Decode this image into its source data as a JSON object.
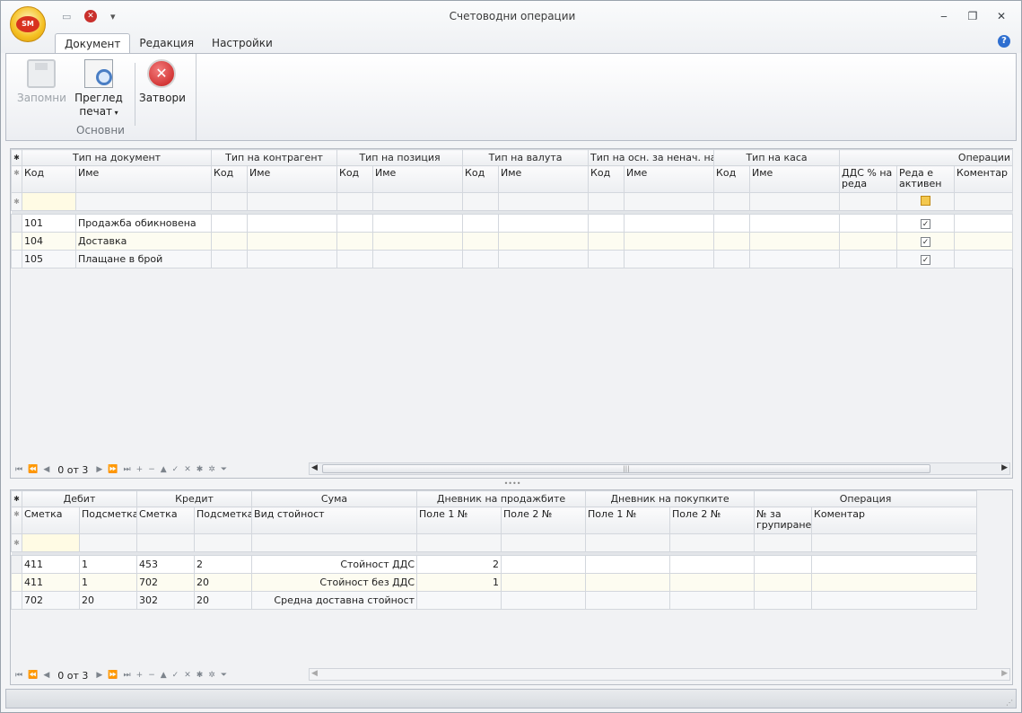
{
  "window": {
    "title": "Счетоводни операции"
  },
  "logo": {
    "text": "SM"
  },
  "tabs": [
    {
      "label": "Документ",
      "active": true
    },
    {
      "label": "Редакция",
      "active": false
    },
    {
      "label": "Настройки",
      "active": false
    }
  ],
  "ribbon": {
    "save_label": "Запомни",
    "preview_label_1": "Преглед",
    "preview_label_2": "печат",
    "close_label": "Затвори",
    "group_label": "Основни"
  },
  "top_grid": {
    "bands": [
      "Тип на документ",
      "Тип на контрагент",
      "Тип на позиция",
      "Тип на валута",
      "Тип на осн. за ненач. на...",
      "Тип на каса",
      "Операции"
    ],
    "code_header": "Код",
    "name_header": "Име",
    "vat_header": "ДДС % на реда",
    "active_header": "Реда е активен",
    "comment_header": "Коментар",
    "rows": [
      {
        "code": "101",
        "name": "Продажба обикновена",
        "active": true
      },
      {
        "code": "104",
        "name": "Доставка",
        "active": true
      },
      {
        "code": "105",
        "name": "Плащане в брой",
        "active": true
      }
    ],
    "nav_position": "0 от 3"
  },
  "bottom_grid": {
    "bands": [
      "Дебит",
      "Кредит",
      "Сума",
      "Дневник на продажбите",
      "Дневник на покупките",
      "Операция"
    ],
    "headers": [
      "Сметка",
      "Подсметка",
      "Сметка",
      "Подсметка",
      "Вид стойност",
      "Поле 1 №",
      "Поле 2 №",
      "Поле 1 №",
      "Поле 2 №",
      "№ за групиране",
      "Коментар"
    ],
    "rows": [
      {
        "debit_account": "411",
        "debit_sub": "1",
        "credit_account": "453",
        "credit_sub": "2",
        "value_type": "Стойност ДДС",
        "sales_field1": "2"
      },
      {
        "debit_account": "411",
        "debit_sub": "1",
        "credit_account": "702",
        "credit_sub": "20",
        "value_type": "Стойност без ДДС",
        "sales_field1": "1"
      },
      {
        "debit_account": "702",
        "debit_sub": "20",
        "credit_account": "302",
        "credit_sub": "20",
        "value_type": "Средна доставна стойност",
        "sales_field1": ""
      }
    ],
    "nav_position": "0 от 3"
  }
}
